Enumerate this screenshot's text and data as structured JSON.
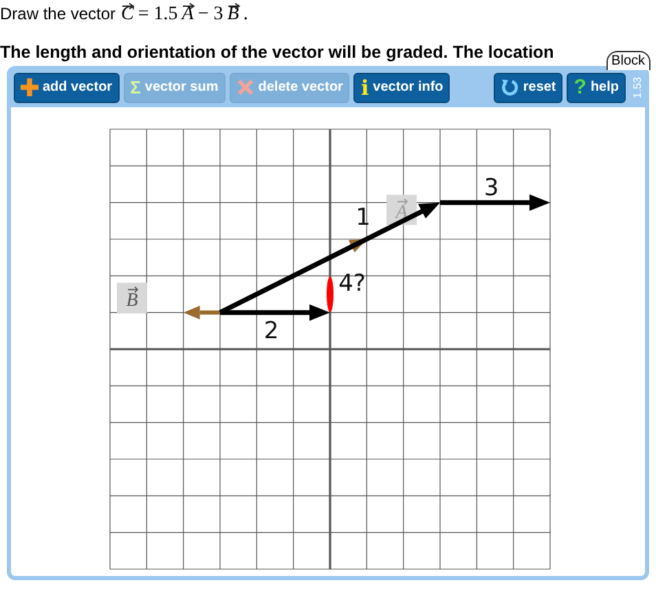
{
  "prompt": {
    "text": "Draw the vector",
    "formula": [
      {
        "kind": "vec",
        "text": "C"
      },
      {
        "kind": "plain",
        "text": "= 1.5"
      },
      {
        "kind": "vec",
        "text": "A"
      },
      {
        "kind": "plain",
        "text": "− 3"
      },
      {
        "kind": "vec",
        "text": "B"
      },
      {
        "kind": "plain",
        "text": "."
      }
    ]
  },
  "instruction": "The length and orientation of the vector will be graded. The location",
  "block_tab": "Block",
  "toolbar": [
    {
      "kind": "plus",
      "label": "add vector",
      "disabled": false
    },
    {
      "kind": "sigma",
      "icon": "Σ",
      "label": "vector sum",
      "disabled": true
    },
    {
      "kind": "cross",
      "label": "delete vector",
      "disabled": true
    },
    {
      "kind": "info",
      "icon": "i",
      "label": "vector info",
      "disabled": false
    },
    {
      "kind": "reset",
      "label": "reset",
      "disabled": false
    },
    {
      "kind": "help",
      "icon": "?",
      "label": "help",
      "disabled": false
    }
  ],
  "version": "1.53",
  "canvas": {
    "vector_labels": [
      "A",
      "B"
    ],
    "step_labels": [
      "1",
      "2",
      "3",
      "4?"
    ]
  }
}
